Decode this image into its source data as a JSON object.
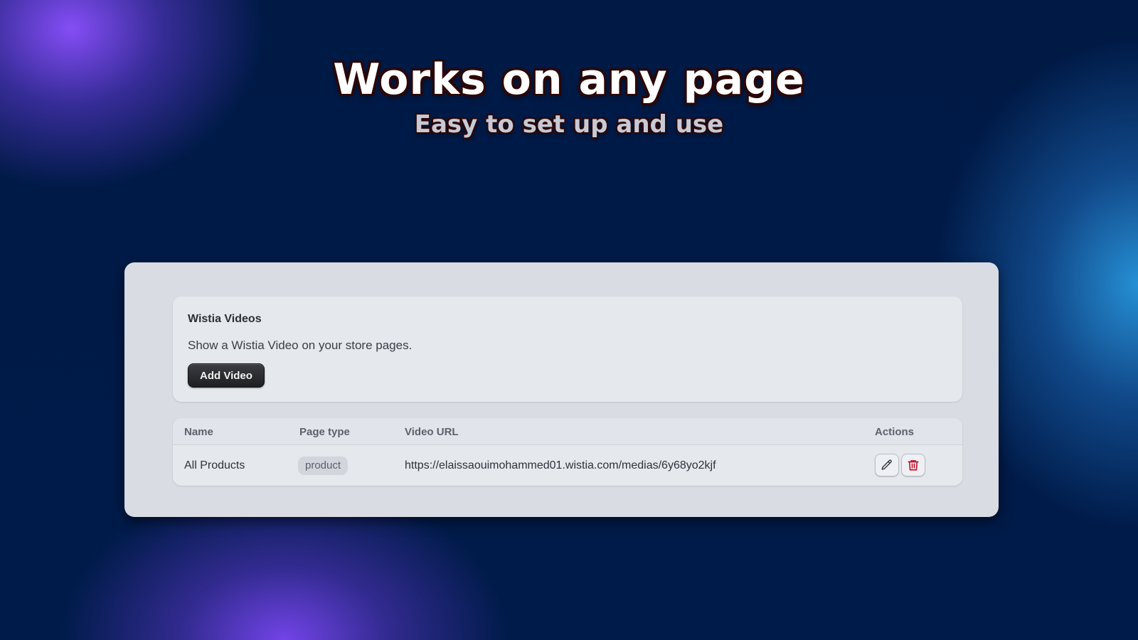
{
  "hero": {
    "title": "Works on any page",
    "subtitle": "Easy to set up and use"
  },
  "card": {
    "title": "Wistia Videos",
    "description": "Show a Wistia Video on your store pages.",
    "add_button_label": "Add Video"
  },
  "table": {
    "headers": {
      "name": "Name",
      "page_type": "Page type",
      "video_url": "Video URL",
      "actions": "Actions"
    },
    "rows": [
      {
        "name": "All Products",
        "page_type": "product",
        "video_url": "https://elaissaouimohammed01.wistia.com/medias/6y68yo2kjf",
        "actions": [
          "pencil-icon",
          "trash-icon"
        ]
      }
    ]
  },
  "colors": {
    "background": "#001a45",
    "panel": "#d9dce2",
    "card": "#e5e8ed",
    "button": "#1e1f23",
    "delete_icon": "#c0142f",
    "edit_icon": "#3a3f47"
  }
}
